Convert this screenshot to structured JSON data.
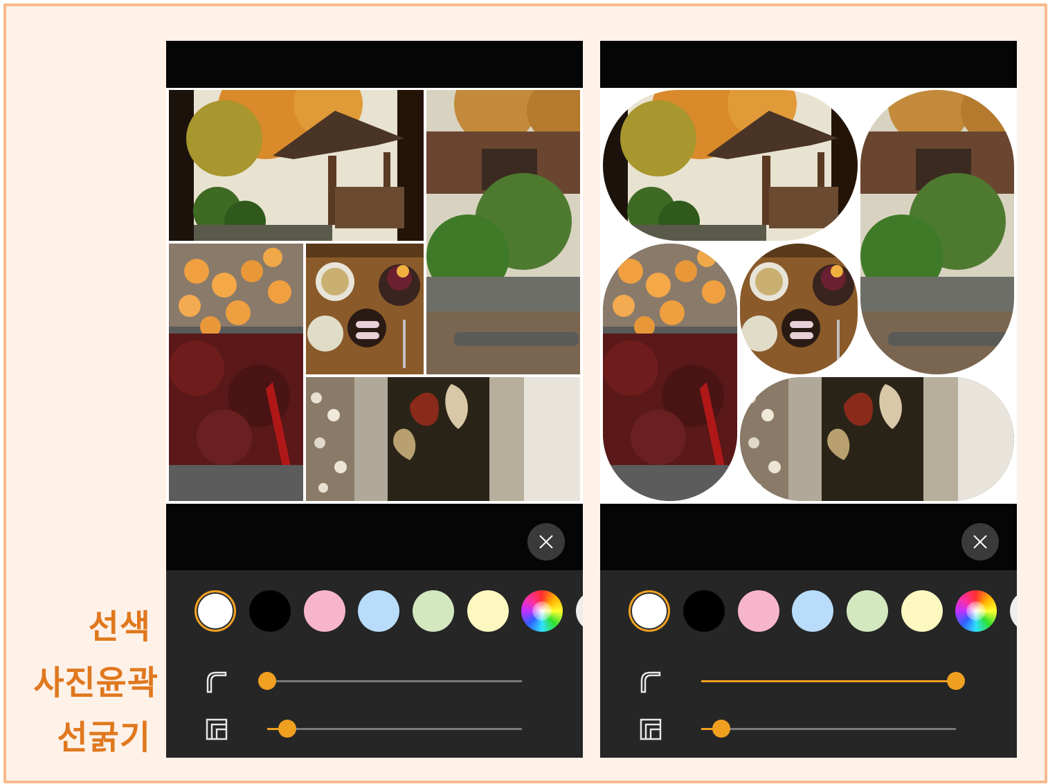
{
  "labels": {
    "line_color": "선색",
    "photo_outline": "사진윤곽",
    "line_thickness": "선굵기"
  },
  "screens": [
    {
      "id": "square",
      "corner_roundness": 0.0,
      "border_thickness": 0.08,
      "selected_swatch": 0
    },
    {
      "id": "rounded",
      "corner_roundness": 1.0,
      "border_thickness": 0.08,
      "selected_swatch": 0
    }
  ],
  "swatches": [
    {
      "name": "white",
      "color": "#ffffff"
    },
    {
      "name": "black",
      "color": "#000000"
    },
    {
      "name": "pink",
      "color": "#f7b5cc"
    },
    {
      "name": "light-blue",
      "color": "#b8dcfa"
    },
    {
      "name": "light-green",
      "color": "#d4e8c0"
    },
    {
      "name": "light-yellow",
      "color": "#fdf8c0"
    },
    {
      "name": "color-wheel",
      "color": "multicolor"
    },
    {
      "name": "more",
      "color": "#eeeeee"
    }
  ],
  "photos": [
    {
      "name": "pavilion-garden-photo"
    },
    {
      "name": "house-garden-photo"
    },
    {
      "name": "dried-persimmon-jujube-photo"
    },
    {
      "name": "tea-patbingsu-photo"
    },
    {
      "name": "stones-leaves-photo"
    }
  ],
  "colors": {
    "accent": "#f0a020",
    "label": "#e0781e",
    "panel": "#262626",
    "frame_border": "#f7b98a",
    "frame_bg": "#fdf1e8"
  },
  "icons": {
    "close": "close-icon",
    "corner": "corner-radius-icon",
    "border": "border-width-icon"
  }
}
